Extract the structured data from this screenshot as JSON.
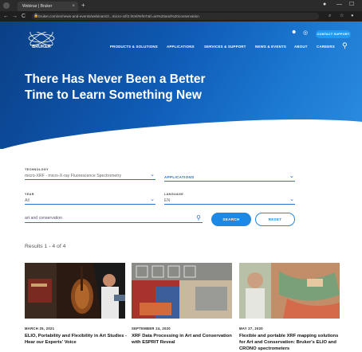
{
  "browser": {
    "tab_title": "Webinar | Bruker",
    "tab_close": "×",
    "new_tab": "+",
    "url": "bruker.com/en/news-and-events/webinars/2...micro-xrf/2.html#efmT&f=art%20and%20conservation",
    "lock": "🔒",
    "back": "←",
    "forward": "→",
    "reload": "C",
    "window_controls": [
      "—",
      "☐"
    ]
  },
  "header": {
    "logo_text": "BRUKER",
    "contact_button": "CONTACT SUPPORT",
    "nav_items": [
      "PRODUCTS & SOLUTIONS",
      "APPLICATIONS",
      "SERVICES & SUPPORT",
      "NEWS & EVENTS",
      "ABOUT",
      "CAREERS"
    ],
    "user_icon": "user-icon",
    "globe_icon": "globe-icon",
    "search_icon": "search-icon"
  },
  "hero": {
    "title_line1": "There Has Never Been a Better",
    "title_line2": "Time to Learn Something New"
  },
  "filters": {
    "technology_label": "TECHNOLOGY",
    "technology_value": "micro-XRF - micro-X-ray Fluorescence Spectrometry",
    "applications_value": "APPLICATIONS",
    "year_label": "YEAR",
    "year_value": "All",
    "language_label": "LANGUAGE",
    "language_value": "EN",
    "search_value": "art and conservation",
    "search_button": "SEARCH",
    "reset_button": "RESET"
  },
  "results": {
    "summary": "Results 1 - 4 of 4"
  },
  "cards": [
    {
      "date": "MARCH 25, 2021",
      "title": "ELIO, Portability and Flexibility in Art Studies - Hear our Experts' Voice"
    },
    {
      "date": "SEPTEMBER 24, 2020",
      "title": "XRF Data Processing in Art and Conservation with ESPRIT Reveal"
    },
    {
      "date": "MAY 27, 2020",
      "title": "Flexible and portable XRF mapping solutions for Art and Conservation: Bruker's ELIO and CRONO spectrometers"
    }
  ],
  "colors": {
    "brand_blue": "#0f5bb5",
    "accent_blue": "#1e88e5",
    "contact_blue": "#1e9bf0"
  }
}
